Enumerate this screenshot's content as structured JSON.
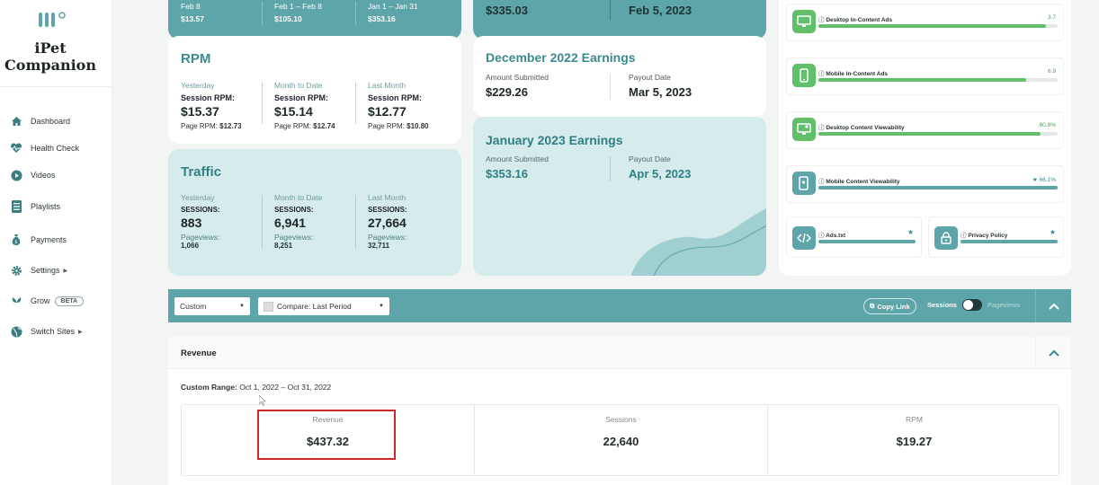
{
  "sidebar": {
    "brand_line1": "iPet",
    "brand_line2": "Companion",
    "items": [
      {
        "label": "Dashboard",
        "icon": "home-icon"
      },
      {
        "label": "Health Check",
        "icon": "heartbeat-icon"
      },
      {
        "label": "Videos",
        "icon": "play-icon"
      },
      {
        "label": "Playlists",
        "icon": "list-icon"
      },
      {
        "label": "Payments",
        "icon": "money-bag-icon"
      },
      {
        "label": "Settings",
        "icon": "gear-icon"
      },
      {
        "label": "Grow",
        "icon": "plant-icon",
        "badge": "BETA"
      },
      {
        "label": "Switch Sites",
        "icon": "globe-icon"
      }
    ]
  },
  "top_teal_card": {
    "cols": [
      {
        "label": "Feb 8",
        "value": "$13.57"
      },
      {
        "label": "Feb 1 – Feb 8",
        "value": "$105.10"
      },
      {
        "label": "Jan 1 – Jan 31",
        "value": "$353.16"
      }
    ]
  },
  "top_payout_card": {
    "amount": "$335.03",
    "date": "Feb 5, 2023"
  },
  "rpm": {
    "title": "RPM",
    "cols": [
      {
        "period": "Yesterday",
        "session_label": "Session RPM:",
        "session_value": "$15.37",
        "page_label": "Page RPM:",
        "page_value": "$12.73"
      },
      {
        "period": "Month to Date",
        "session_label": "Session RPM:",
        "session_value": "$15.14",
        "page_label": "Page RPM:",
        "page_value": "$12.74"
      },
      {
        "period": "Last Month",
        "session_label": "Session RPM:",
        "session_value": "$12.77",
        "page_label": "Page RPM:",
        "page_value": "$10.80"
      }
    ]
  },
  "traffic": {
    "title": "Traffic",
    "cols": [
      {
        "period": "Yesterday",
        "sessions_label": "SESSIONS:",
        "sessions": "883",
        "pv_label": "Pageviews:",
        "pageviews": "1,066"
      },
      {
        "period": "Month to Date",
        "sessions_label": "SESSIONS:",
        "sessions": "6,941",
        "pv_label": "Pageviews:",
        "pageviews": "8,251"
      },
      {
        "period": "Last Month",
        "sessions_label": "SESSIONS:",
        "sessions": "27,664",
        "pv_label": "Pageviews:",
        "pageviews": "32,711"
      }
    ]
  },
  "dec_earnings": {
    "title": "December 2022 Earnings",
    "amount_label": "Amount Submitted",
    "amount": "$229.26",
    "date_label": "Payout Date",
    "date": "Mar 5, 2023"
  },
  "jan_earnings": {
    "title": "January 2023 Earnings",
    "amount_label": "Amount Submitted",
    "amount": "$353.16",
    "date_label": "Payout Date",
    "date": "Apr 5, 2023"
  },
  "health": {
    "items": [
      {
        "name": "Desktop In-Content Ads",
        "value": "3.7",
        "fill": 0.95,
        "color": "#5fbf6a",
        "icon": "desktop-icon"
      },
      {
        "name": "Mobile In-Content Ads",
        "value": "6.9",
        "fill": 0.87,
        "color": "#5fbf6a",
        "icon": "mobile-icon"
      },
      {
        "name": "Desktop Content Viewability",
        "value": "60.8%",
        "fill": 0.93,
        "color": "#5fbf6a",
        "icon": "desktop-eye-icon"
      },
      {
        "name": "Mobile Content Viewability",
        "value": "66.1%",
        "fill": 1.0,
        "color": "#5ea5a9",
        "icon": "mobile-eye-icon"
      },
      {
        "name": "Ads.txt",
        "fill": 1.0,
        "color": "#5ea5a9",
        "icon": "code-icon"
      },
      {
        "name": "Privacy Policy",
        "fill": 1.0,
        "color": "#5ea5a9",
        "icon": "lock-icon"
      }
    ]
  },
  "filter": {
    "range": "Custom",
    "compare": "Compare: Last Period",
    "copy_link": "Copy Link",
    "sessions": "Sessions",
    "pageviews": "Pageviews"
  },
  "revenue_section": {
    "title": "Revenue",
    "range_label": "Custom Range:",
    "range_value": "Oct 1, 2022 – Oct 31, 2022",
    "stats": [
      {
        "label": "Revenue",
        "value": "$437.32"
      },
      {
        "label": "Sessions",
        "value": "22,640"
      },
      {
        "label": "RPM",
        "value": "$19.27"
      }
    ]
  },
  "colors": {
    "teal": "#5ea5a9",
    "light_teal": "#d6ebeb",
    "green": "#5fbf6a",
    "highlight": "#cc2a2a"
  }
}
